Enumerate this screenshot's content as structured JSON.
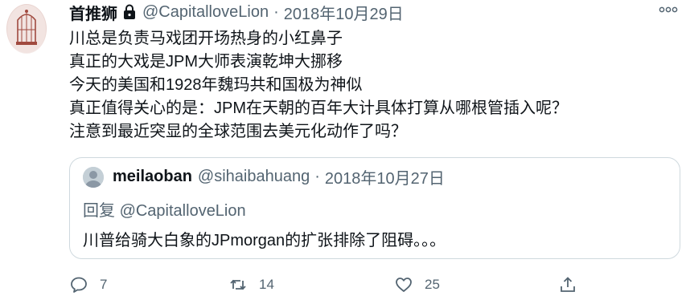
{
  "tweet": {
    "display_name": "首推狮",
    "handle": "@CapitalloveLion",
    "separator": "·",
    "date": "2018年10月29日",
    "text": "川总是负责马戏团开场热身的小红鼻子\n真正的大戏是JPM大师表演乾坤大挪移\n今天的美国和1928年魏玛共和国极为神似\n真正值得关心的是：JPM在天朝的百年大计具体打算从哪根管插入呢？\n注意到最近突显的全球范围去美元化动作了吗？",
    "protected_icon": "lock-icon",
    "more_icon": "more-dots-icon"
  },
  "quote": {
    "display_name": "meilaoban",
    "handle": "@sihaibahuang",
    "separator": "·",
    "date": "2018年10月27日",
    "reply_prefix": "回复",
    "reply_to": "@CapitalloveLion",
    "text": "川普给骑大白象的JPmorgan的扩张排除了阻碍。。。"
  },
  "actions": {
    "reply": {
      "icon": "reply-icon",
      "count": "7"
    },
    "retweet": {
      "icon": "retweet-icon",
      "count": "14"
    },
    "like": {
      "icon": "heart-icon",
      "count": "25"
    },
    "share": {
      "icon": "share-icon"
    }
  },
  "colors": {
    "text_primary": "#0f1419",
    "text_secondary": "#536471",
    "border": "#cfd9de",
    "icon": "#536471"
  }
}
